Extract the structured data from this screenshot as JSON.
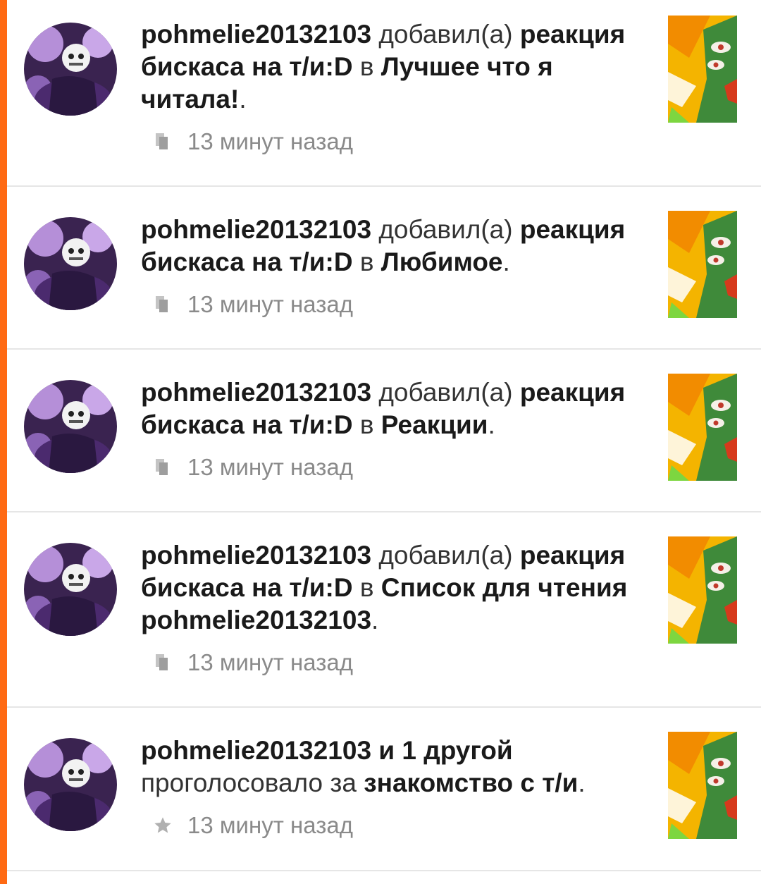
{
  "colors": {
    "accent": "#ff6a13",
    "divider": "#e6e6e6",
    "meta_text": "#8a8a8a"
  },
  "items": [
    {
      "user": "pohmelie20132103",
      "action": "добавил(а)",
      "story": "реакция бискаса на т/и:D",
      "preposition": "в",
      "target": "Лучшее что я читала!",
      "end": ".",
      "time": "13 минут назад",
      "meta_icon": "library-add-icon"
    },
    {
      "user": "pohmelie20132103",
      "action": "добавил(а)",
      "story": "реакция бискаса на т/и:D",
      "preposition": "в",
      "target": "Любимое",
      "end": ".",
      "time": "13 минут назад",
      "meta_icon": "library-add-icon"
    },
    {
      "user": "pohmelie20132103",
      "action": "добавил(а)",
      "story": "реакция бискаса на т/и:D",
      "preposition": "в",
      "target": "Реакции",
      "end": ".",
      "time": "13 минут назад",
      "meta_icon": "library-add-icon"
    },
    {
      "user": "pohmelie20132103",
      "action": "добавил(а)",
      "story": "реакция бискаса на т/и:D",
      "preposition": "в",
      "target": "Список для чтения pohmelie20132103",
      "end": ".",
      "time": "13 минут назад",
      "meta_icon": "library-add-icon"
    },
    {
      "user": "pohmelie20132103",
      "others": "и 1 другой",
      "action": "проголосовало за",
      "story": "знакомство с т/и",
      "end": ".",
      "time": "13 минут назад",
      "meta_icon": "star-icon"
    }
  ]
}
